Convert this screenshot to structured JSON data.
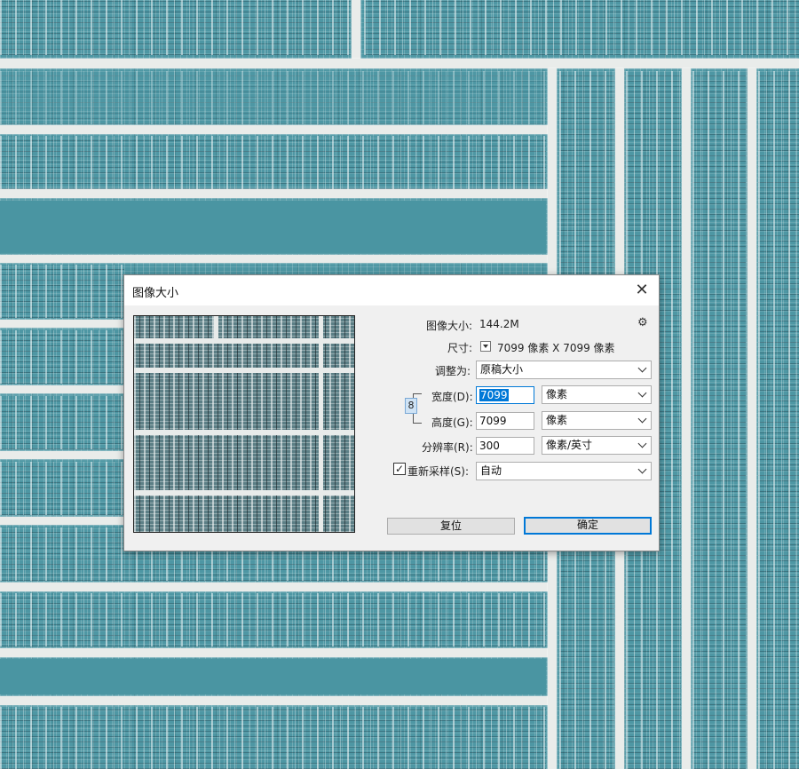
{
  "dialog": {
    "title": "图像大小",
    "close_symbol": "✕",
    "image_size_label": "图像大小:",
    "image_size_value": "144.2M",
    "dimensions_label": "尺寸:",
    "dimensions_value": "7099 像素  X  7099 像素",
    "fit_to_label": "调整为:",
    "fit_to_value": "原稿大小",
    "width_label": "宽度(D):",
    "width_value": "7099",
    "width_unit": "像素",
    "height_label": "高度(G):",
    "height_value": "7099",
    "height_unit": "像素",
    "resolution_label": "分辨率(R):",
    "resolution_value": "300",
    "resolution_unit": "像素/英寸",
    "resample_label": "重新采样(S):",
    "resample_checked": true,
    "resample_check_symbol": "✓",
    "resample_value": "自动",
    "reset_button": "复位",
    "ok_button": "确定",
    "gear_symbol": "⚙",
    "link_symbol": "8"
  },
  "icons": {
    "close": "close-icon",
    "gear": "gear-icon",
    "link": "link-icon",
    "chevron": "chevron-down-icon"
  },
  "colors": {
    "background_teal": "#4e97a4",
    "band_white": "#e9ecea",
    "accent_blue": "#0078d7",
    "dialog_bg": "#f0f0f0"
  }
}
